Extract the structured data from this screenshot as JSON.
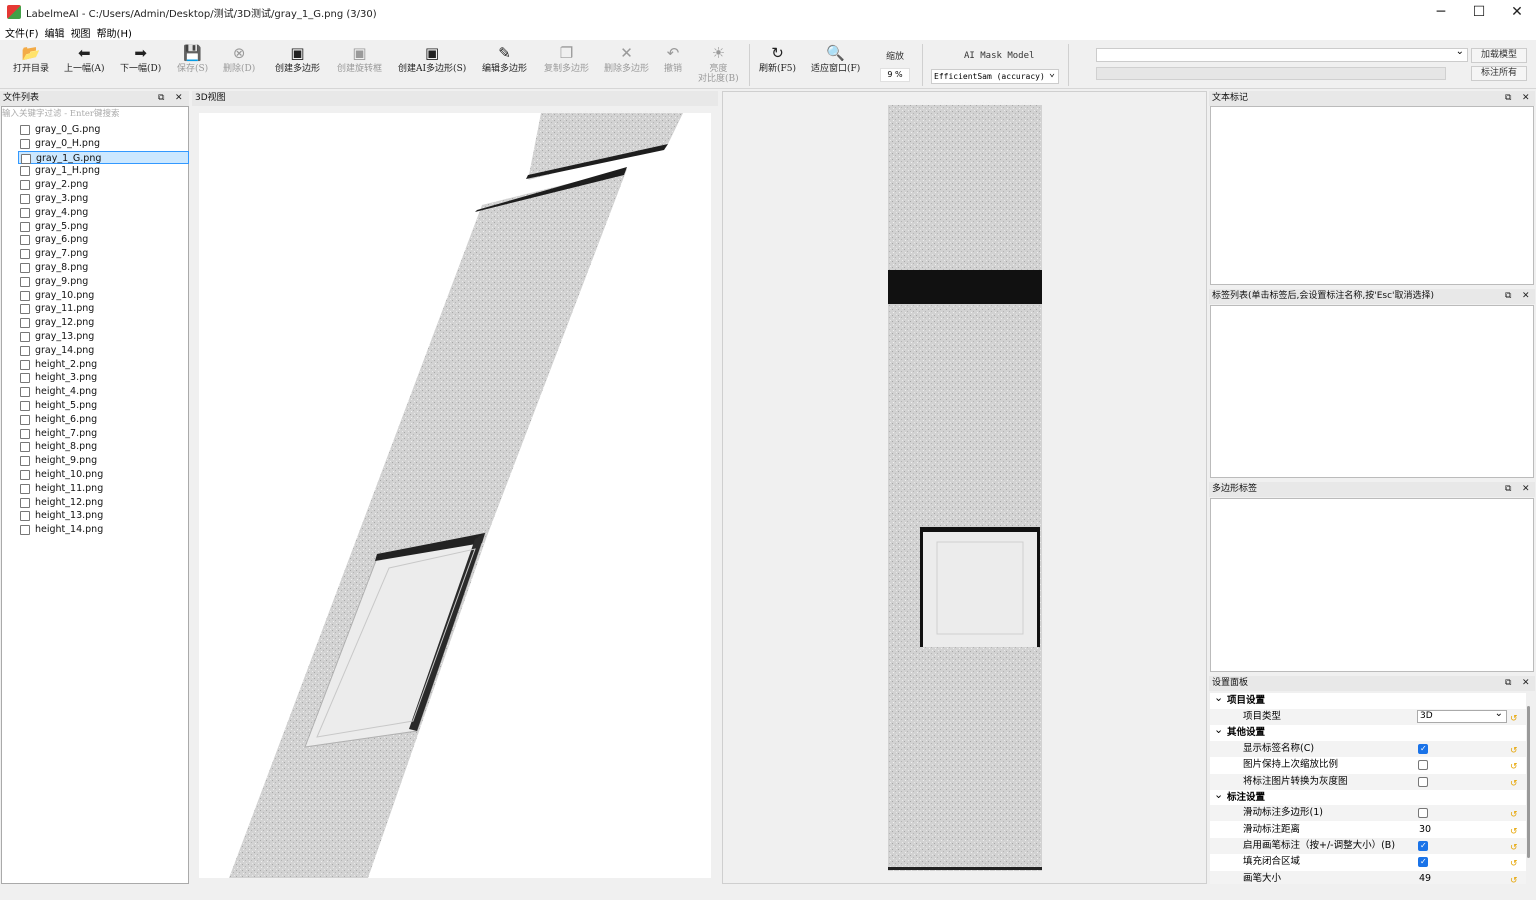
{
  "window": {
    "title": "LabelmeAI - C:/Users/Admin/Desktop/测试/3D测试/gray_1_G.png (3/30)",
    "controls": [
      "─",
      "☐",
      "✕"
    ]
  },
  "menu": [
    "文件(F)",
    "编辑",
    "视图",
    "帮助(H)"
  ],
  "toolbar": {
    "buttons": [
      {
        "label": "打开目录",
        "icon": "folder-icon",
        "glyph": "📂",
        "enabled": true
      },
      {
        "label": "上一幅(A)",
        "icon": "arrow-left-icon",
        "glyph": "⬅",
        "enabled": true
      },
      {
        "label": "下一幅(D)",
        "icon": "arrow-right-icon",
        "glyph": "➡",
        "enabled": true
      },
      {
        "label": "保存(S)",
        "icon": "save-icon",
        "glyph": "💾",
        "enabled": false
      },
      {
        "label": "删除(D)",
        "icon": "delete-circle-icon",
        "glyph": "⊗",
        "enabled": false
      },
      {
        "label": "创建多边形",
        "icon": "polygon-icon",
        "glyph": "▣",
        "enabled": true
      },
      {
        "label": "创建旋转框",
        "icon": "rotated-box-icon",
        "glyph": "▣",
        "enabled": false
      },
      {
        "label": "创建AI多边形(S)",
        "icon": "ai-polygon-icon",
        "glyph": "▣",
        "enabled": true
      },
      {
        "label": "编辑多边形",
        "icon": "edit-polygon-icon",
        "glyph": "✎",
        "enabled": true
      },
      {
        "label": "复制多边形",
        "icon": "copy-icon",
        "glyph": "❐",
        "enabled": false
      },
      {
        "label": "删除多边形",
        "icon": "delete-x-icon",
        "glyph": "✕",
        "enabled": false
      },
      {
        "label": "撤销",
        "icon": "undo-icon",
        "glyph": "↶",
        "enabled": false
      },
      {
        "label": "亮度\n对比度(B)",
        "icon": "brightness-icon",
        "glyph": "☀",
        "enabled": false
      },
      {
        "label": "刷新(F5)",
        "icon": "refresh-icon",
        "glyph": "↻",
        "enabled": true
      },
      {
        "label": "适应窗口(F)",
        "icon": "zoom-fit-icon",
        "glyph": "🔍",
        "enabled": true
      }
    ],
    "zoom_label": "缩放",
    "zoom_value": "9 %",
    "ai_model_label": "AI Mask Model",
    "ai_model_value": "EfficientSam (accuracy)",
    "load_model_button": "加载模型",
    "annotate_all_button": "标注所有"
  },
  "file_panel": {
    "title": "文件列表",
    "filter_placeholder": "输入关键字过滤 - Enter键搜索",
    "files": [
      "gray_0_G.png",
      "gray_0_H.png",
      "gray_1_G.png",
      "gray_1_H.png",
      "gray_2.png",
      "gray_3.png",
      "gray_4.png",
      "gray_5.png",
      "gray_6.png",
      "gray_7.png",
      "gray_8.png",
      "gray_9.png",
      "gray_10.png",
      "gray_11.png",
      "gray_12.png",
      "gray_13.png",
      "gray_14.png",
      "height_2.png",
      "height_3.png",
      "height_4.png",
      "height_5.png",
      "height_6.png",
      "height_7.png",
      "height_8.png",
      "height_9.png",
      "height_10.png",
      "height_11.png",
      "height_12.png",
      "height_13.png",
      "height_14.png"
    ],
    "selected_index": 2
  },
  "view3d": {
    "title": "3D视图"
  },
  "dock_panels": {
    "text_label": "文本标记",
    "label_list": "标签列表(单击标签后,会设置标注名称,按'Esc'取消选择)",
    "polygon_labels": "多边形标签",
    "settings": "设置面板",
    "float_icon": "⧉",
    "close_icon": "✕"
  },
  "settings": {
    "project_group": "项目设置",
    "project_type_label": "项目类型",
    "project_type_value": "3D",
    "other_group": "其他设置",
    "show_label_name": "显示标签名称(C)",
    "show_label_name_checked": true,
    "keep_zoom": "图片保持上次缩放比例",
    "keep_zoom_checked": false,
    "to_gray": "将标注图片转换为灰度图",
    "to_gray_checked": false,
    "annot_group": "标注设置",
    "slide_polygon": "滑动标注多边形(1)",
    "slide_polygon_checked": false,
    "slide_distance_label": "滑动标注距离",
    "slide_distance_value": "30",
    "brush_enable": "启用画笔标注（按+/-调整大小）(B)",
    "brush_enable_checked": true,
    "fill_closed": "填充闭合区域",
    "fill_closed_checked": true,
    "brush_size_label": "画笔大小",
    "brush_size_value": "49",
    "reset_icon": "↺"
  }
}
